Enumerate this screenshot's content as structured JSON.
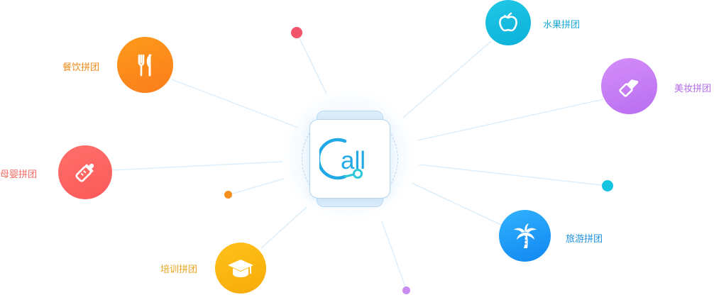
{
  "center": {
    "logo_text": "all",
    "colors": {
      "c_stroke": "#21a9e6",
      "text": "#21a9e6",
      "accent_dot": "#2ec9d8"
    }
  },
  "categories": [
    {
      "key": "food",
      "label": "餐饮拼团",
      "icon": "fork-knife-icon",
      "color_from": "#fd9a1a",
      "color_to": "#fb7d1c",
      "label_color": "#ef8a1a"
    },
    {
      "key": "baby",
      "label": "母婴拼团",
      "icon": "baby-bottle-icon",
      "color_from": "#ff6f6a",
      "color_to": "#fb5a5a",
      "label_color": "#f06a64"
    },
    {
      "key": "training",
      "label": "培训拼团",
      "icon": "graduation-cap-icon",
      "color_from": "#ffc21a",
      "color_to": "#f7aa09",
      "label_color": "#e6a31a"
    },
    {
      "key": "fruit",
      "label": "水果拼团",
      "icon": "apple-icon",
      "color_from": "#22c8e6",
      "color_to": "#0ab0d8",
      "label_color": "#19a9d6"
    },
    {
      "key": "beauty",
      "label": "美妆拼团",
      "icon": "lipstick-icon",
      "color_from": "#d58ef9",
      "color_to": "#b86df0",
      "label_color": "#b16ae6"
    },
    {
      "key": "travel",
      "label": "旅游拼团",
      "icon": "palm-tree-icon",
      "color_from": "#31b3ff",
      "color_to": "#1086f0",
      "label_color": "#1e90e0"
    }
  ],
  "dots": [
    {
      "key": "red",
      "color": "#f2546b"
    },
    {
      "key": "orange",
      "color": "#f5901e"
    },
    {
      "key": "violet",
      "color": "#c98bef"
    },
    {
      "key": "cyan",
      "color": "#16c3e0"
    }
  ],
  "line_color": "#d9ecfa"
}
